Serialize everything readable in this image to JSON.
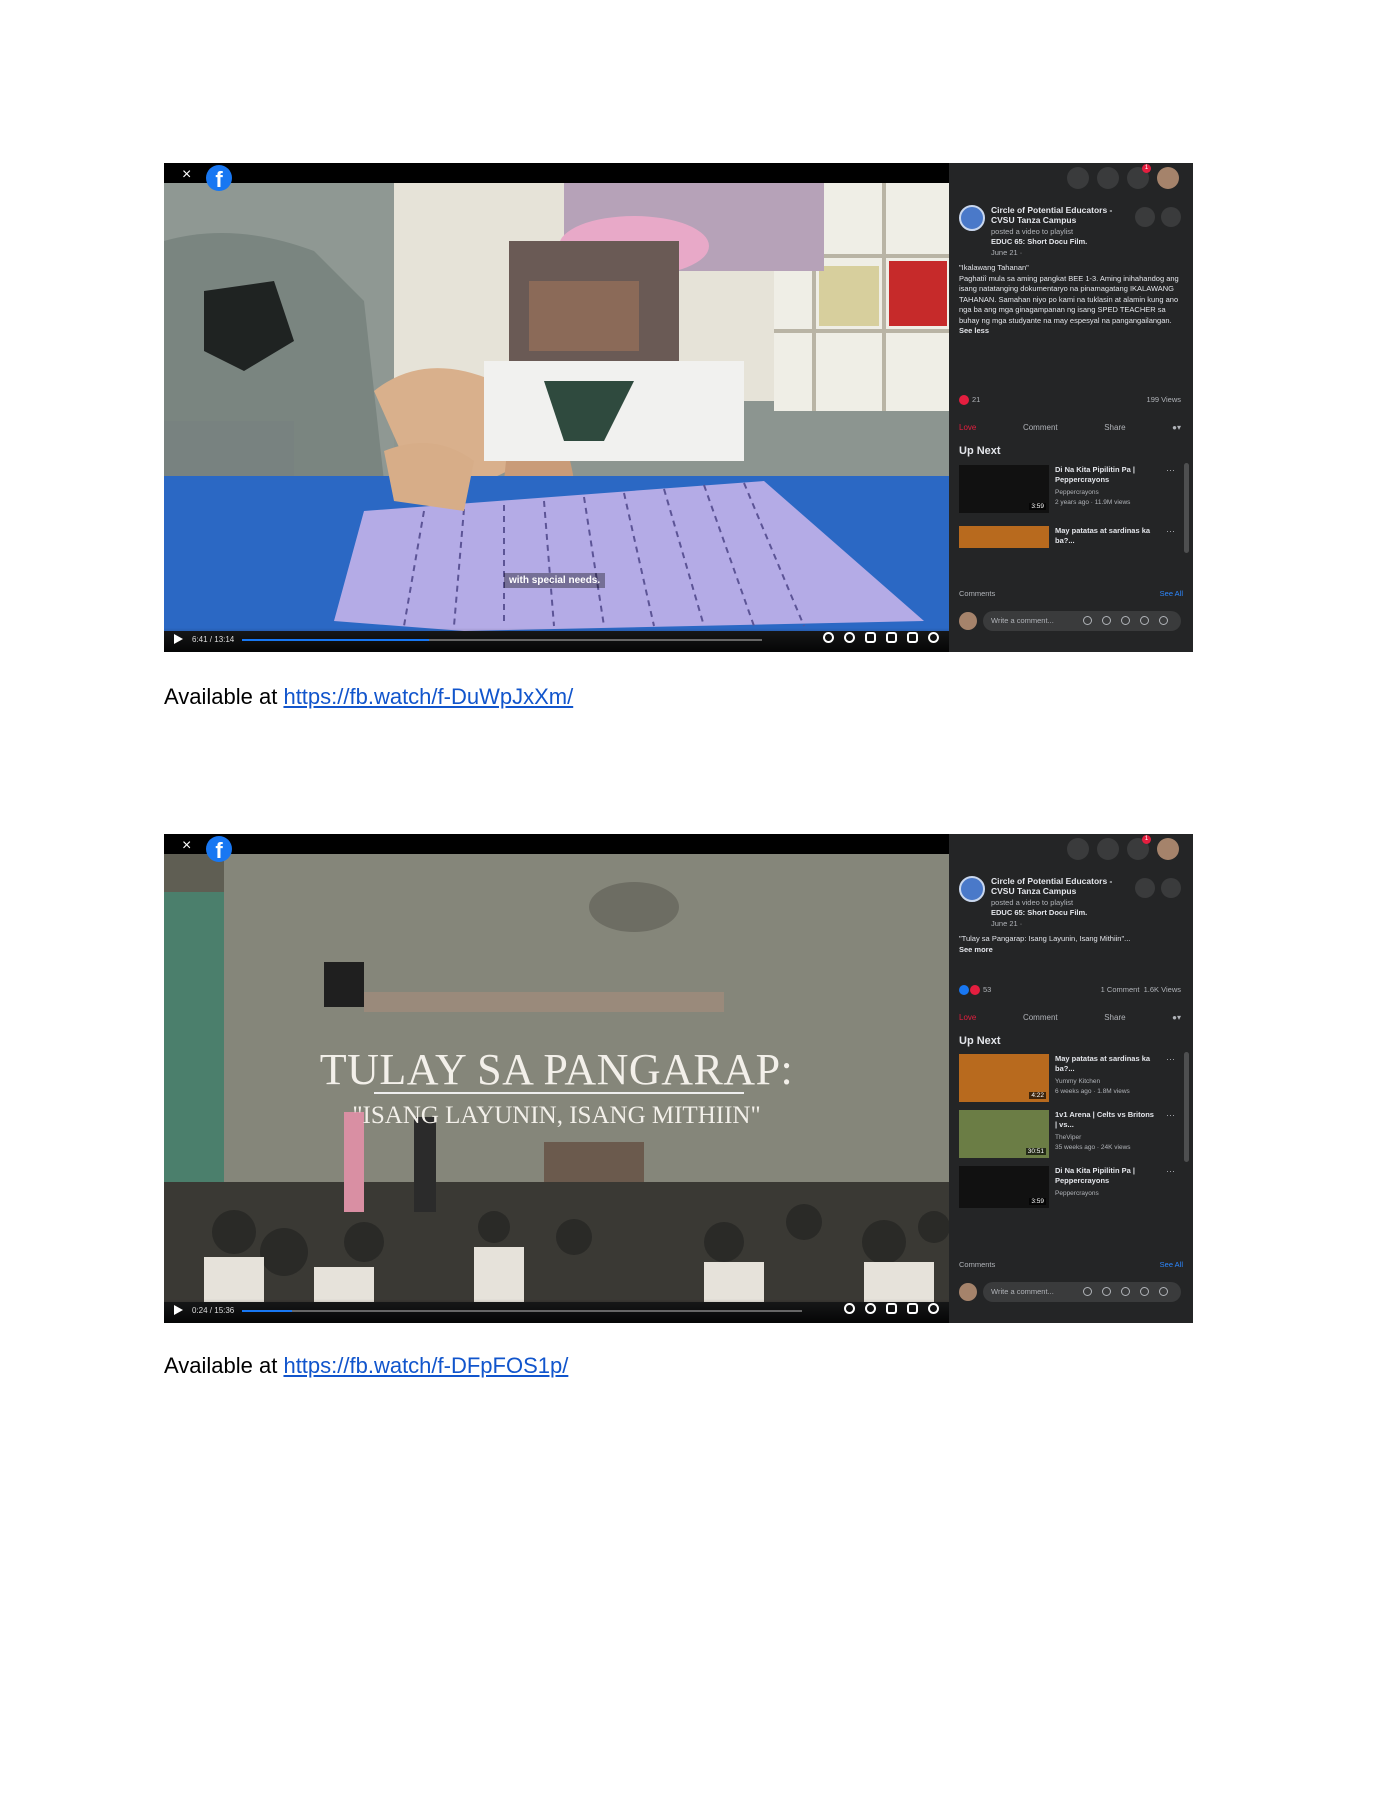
{
  "shot1": {
    "fb_logo": "f",
    "close": "×",
    "caption": "with special needs.",
    "time": "6:41 / 13:14",
    "progress": 0.36,
    "page_name": "Circle of Potential Educators -CVSU Tanza Campus",
    "posted": "posted a video to playlist",
    "playlist": "EDUC 65: Short Docu Film.",
    "date": "June 21 · ",
    "title_line": "\"Ikalawang Tahanan\"",
    "description": "Paghatiî mula sa aming pangkat BEE 1-3. Aming inihahandog ang isang natatanging dokumentaryo na pinamagatang IKALAWANG TAHANAN. Samahan niyo po kami na tuklasin at alamin kung ano nga ba ang mga ginagampanan ng isang SPED TEACHER sa buhay ng mga studyante na may espesyal na pangangailangan.",
    "see_toggle": "See less",
    "reactions": "21",
    "views": "199 Views",
    "actions": {
      "love": "Love",
      "comment": "Comment",
      "share": "Share"
    },
    "up_next": "Up Next",
    "items": [
      {
        "title": "Di Na Kita Pipilitin Pa | Peppercrayons",
        "channel": "Peppercrayons",
        "meta": "2 years ago · 11.9M views",
        "duration": "3:59"
      },
      {
        "title": "May patatas at sardinas ka ba?...",
        "channel": "",
        "meta": "",
        "duration": ""
      }
    ],
    "comments_label": "Comments",
    "see_all": "See All",
    "write_placeholder": "Write a comment..."
  },
  "link1": {
    "prefix": "Available at ",
    "url": "https://fb.watch/f-DuWpJxXm/"
  },
  "shot2": {
    "fb_logo": "f",
    "close": "×",
    "overlay_title": "TULAY SA PANGARAP:",
    "overlay_sub": "\"ISANG LAYUNIN, ISANG MITHIIN\"",
    "time": "0:24 / 15:36",
    "progress": 0.09,
    "page_name": "Circle of Potential Educators -CVSU Tanza Campus",
    "posted": "posted a video to playlist",
    "playlist": "EDUC 65: Short Docu Film.",
    "date": "June 21 · ",
    "description": "\"Tulay sa Pangarap: Isang Layunin, Isang Mithiin\"...",
    "see_toggle": "See more",
    "reactions": "53",
    "comment_count": "1 Comment",
    "views": "1.6K Views",
    "actions": {
      "love": "Love",
      "comment": "Comment",
      "share": "Share"
    },
    "up_next": "Up Next",
    "items": [
      {
        "title": "May patatas at sardinas ka ba?...",
        "channel": "Yummy Kitchen",
        "meta": "6 weeks ago · 1.8M views",
        "duration": "4:22"
      },
      {
        "title": "1v1 Arena | Celts vs Britons | vs...",
        "channel": "TheViper",
        "meta": "35 weeks ago · 24K views",
        "duration": "30:51"
      },
      {
        "title": "Di Na Kita Pipilitin Pa | Peppercrayons",
        "channel": "Peppercrayons",
        "meta": "",
        "duration": "3:59"
      }
    ],
    "comments_label": "Comments",
    "see_all": "See All",
    "write_placeholder": "Write a comment..."
  },
  "link2": {
    "prefix": "Available at ",
    "url": "https://fb.watch/f-DFpFOS1p/"
  },
  "colors": {
    "fb_blue": "#1877f2",
    "love_red": "#e41e3f",
    "link_blue": "#1155cc",
    "panel": "#242526"
  }
}
